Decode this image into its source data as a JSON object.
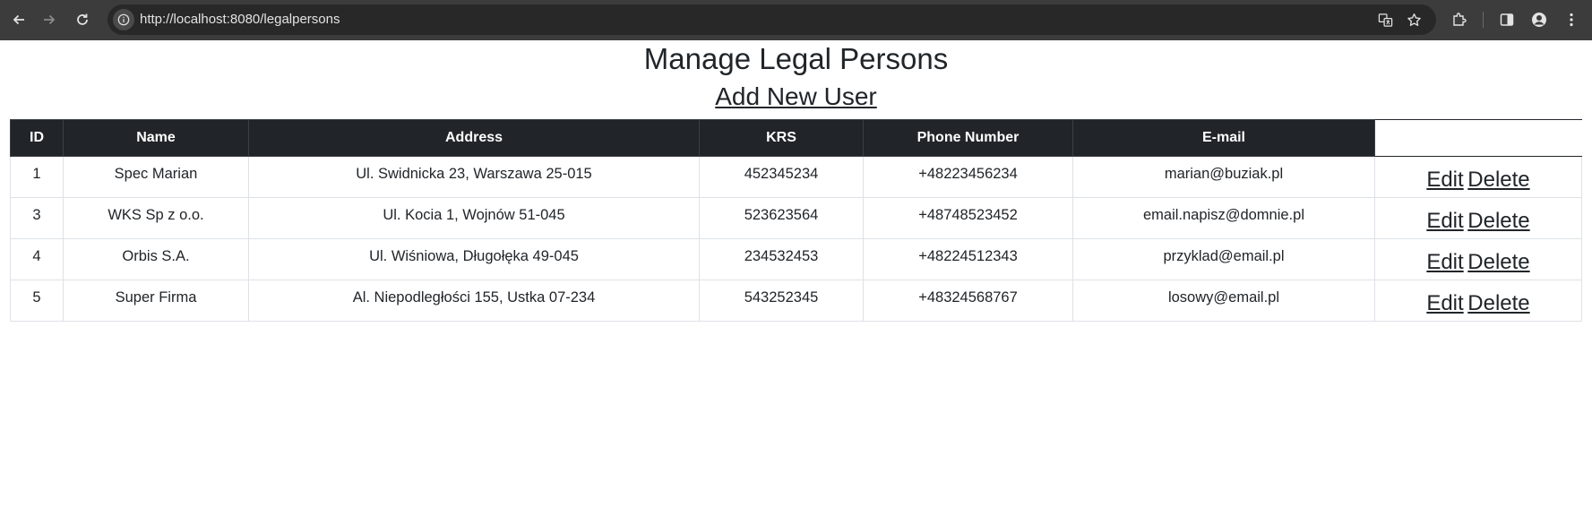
{
  "browser": {
    "url": "http://localhost:8080/legalpersons",
    "icons": [
      "back-icon",
      "forward-icon",
      "reload-icon",
      "site-info-icon",
      "translate-icon",
      "star-icon",
      "extensions-icon",
      "side-panel-icon",
      "profile-icon",
      "menu-icon"
    ]
  },
  "page": {
    "title": "Manage Legal Persons",
    "add_link": "Add New User"
  },
  "table": {
    "headers": [
      "ID",
      "Name",
      "Address",
      "KRS",
      "Phone Number",
      "E-mail",
      ""
    ],
    "rows": [
      {
        "id": "1",
        "name": "Spec Marian",
        "address": "Ul. Swidnicka 23, Warszawa 25-015",
        "krs": "452345234",
        "phone": "+48223456234",
        "email": "marian@buziak.pl",
        "edit": "Edit",
        "delete": "Delete"
      },
      {
        "id": "3",
        "name": "WKS Sp z o.o.",
        "address": "Ul. Kocia 1, Wojnów 51-045",
        "krs": "523623564",
        "phone": "+48748523452",
        "email": "email.napisz@domnie.pl",
        "edit": "Edit",
        "delete": "Delete"
      },
      {
        "id": "4",
        "name": "Orbis S.A.",
        "address": "Ul. Wiśniowa, Długołęka 49-045",
        "krs": "234532453",
        "phone": "+48224512343",
        "email": "przyklad@email.pl",
        "edit": "Edit",
        "delete": "Delete"
      },
      {
        "id": "5",
        "name": "Super Firma",
        "address": "Al. Niepodległości 155, Ustka 07-234",
        "krs": "543252345",
        "phone": "+48324568767",
        "email": "losowy@email.pl",
        "edit": "Edit",
        "delete": "Delete"
      }
    ]
  }
}
